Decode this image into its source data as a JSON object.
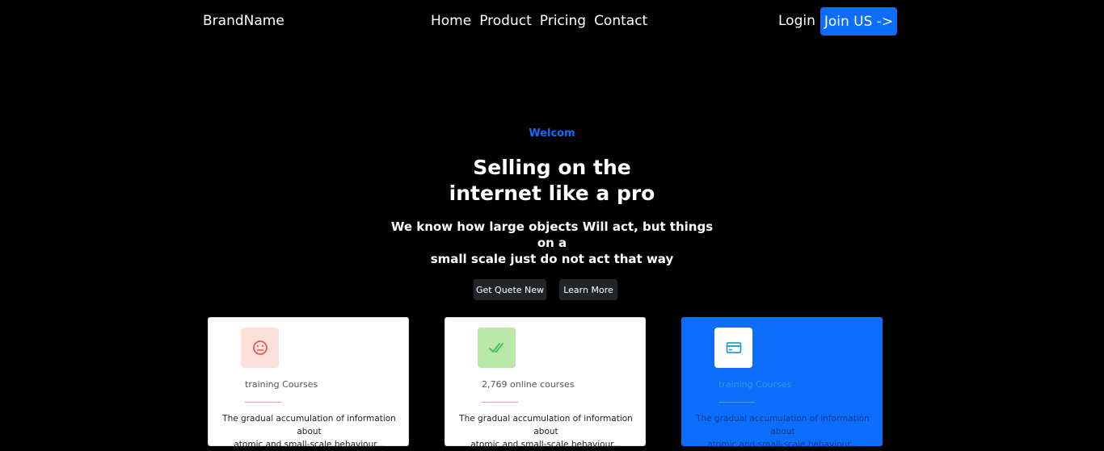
{
  "nav": {
    "brand": "BrandName",
    "links": [
      "Home",
      "Product",
      "Pricing",
      "Contact"
    ],
    "login": "Login",
    "join": "Join US ->"
  },
  "hero": {
    "eyebrow": "Welcom",
    "title_line1": "Selling on the",
    "title_line2": "internet like a pro",
    "subtitle_line1": "We know how large objects Will act, but things on a",
    "subtitle_line2": "small scale just do not act that way",
    "quote_button": "Get Quete New",
    "learn_button": "Learn More"
  },
  "cards": [
    {
      "icon": "sad-face-icon",
      "title": "training Courses",
      "desc_line1": "The gradual accumulation of information about",
      "desc_line2": "atomic and small-scale behaviour..."
    },
    {
      "icon": "double-check-icon",
      "title": "2,769 online courses",
      "desc_line1": "The gradual accumulation of information about",
      "desc_line2": "atomic and small-scale behaviour..."
    },
    {
      "icon": "credit-card-icon",
      "title": "training Courses",
      "desc_line1": "The gradual accumulation of information about",
      "desc_line2": "atomic and small-scale behaviour..."
    }
  ],
  "colors": {
    "accent": "#0d6efd",
    "background": "#000000"
  }
}
